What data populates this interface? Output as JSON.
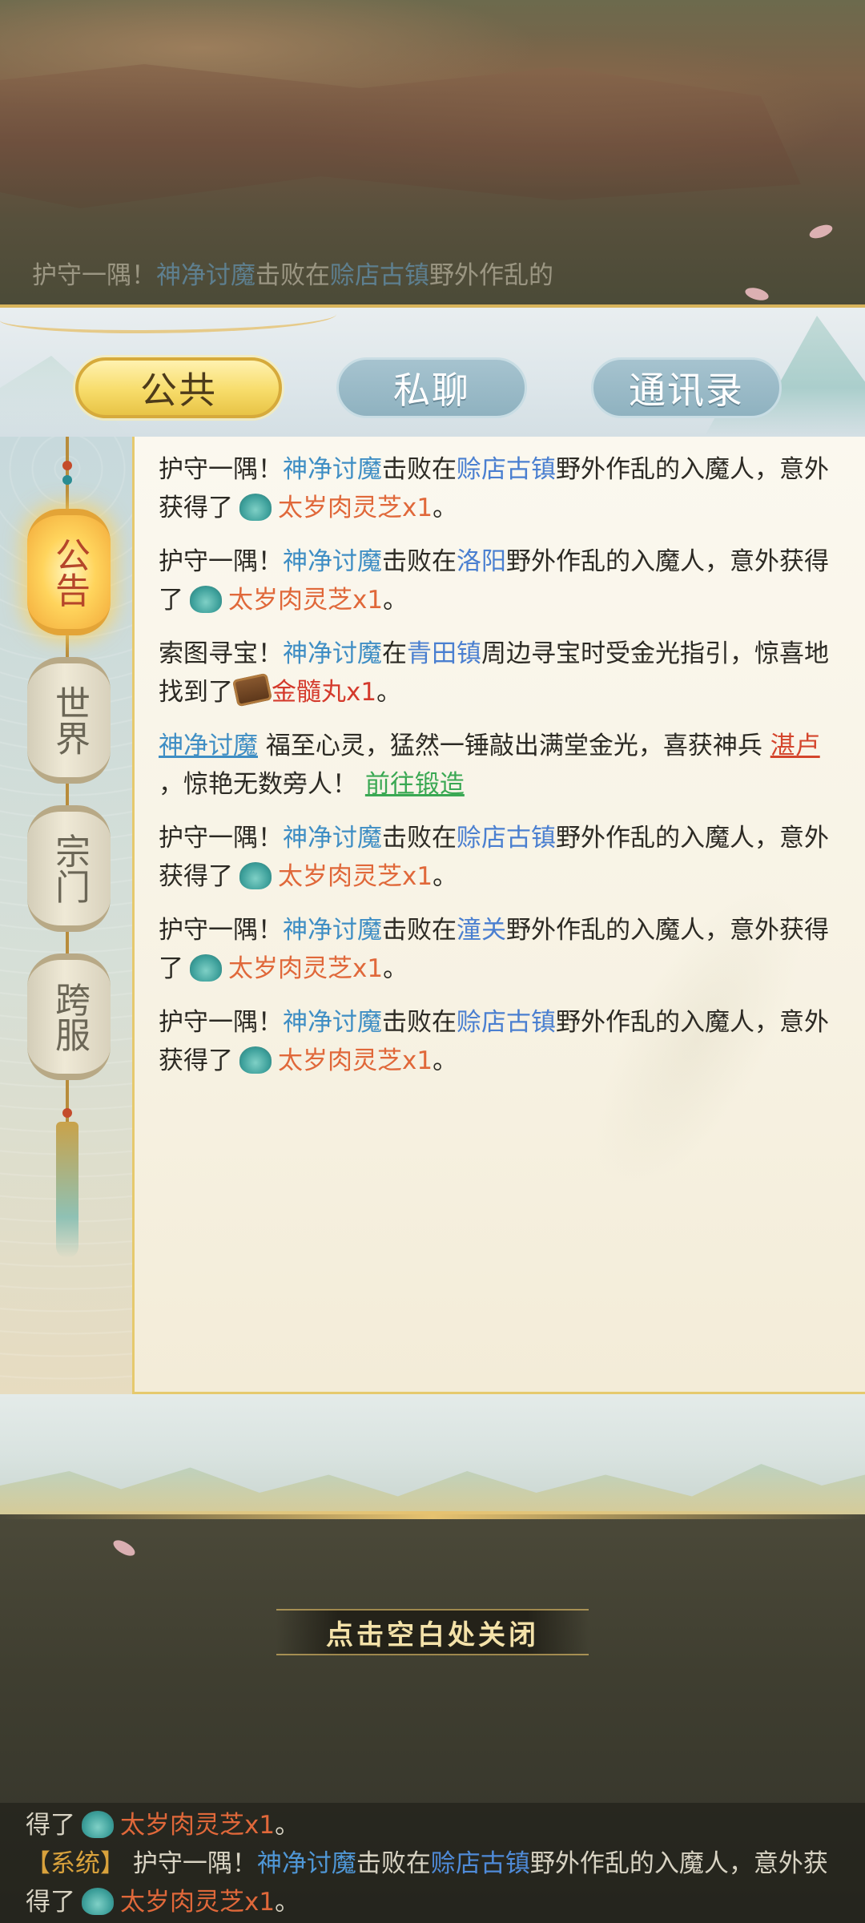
{
  "background_ticker": {
    "prefix": "护守一隅！",
    "player": "神净讨魔",
    "mid": "击败在",
    "location": "赊店古镇",
    "suffix": "野外作乱的"
  },
  "tabs": {
    "public": "公共",
    "private": "私聊",
    "contacts": "通讯录"
  },
  "channels": [
    "公告",
    "世界",
    "宗门",
    "跨服"
  ],
  "messages": [
    {
      "prefix": "护守一隅！",
      "player": "神净讨魔",
      "mid": "击败在",
      "location": "赊店古镇",
      "suffix": "野外作乱的入魔人，意外获得了",
      "item": "太岁肉灵芝x1",
      "end": "。"
    },
    {
      "prefix": "护守一隅！",
      "player": "神净讨魔",
      "mid": "击败在",
      "location": "洛阳",
      "suffix": "野外作乱的入魔人，意外获得了",
      "item": "太岁肉灵芝x1",
      "end": "。"
    },
    {
      "prefix": "索图寻宝！",
      "player": "神净讨魔",
      "mid": "在",
      "location": "青田镇",
      "suffix": "周边寻宝时受金光指引，惊喜地找到了",
      "item": "金髓丸x1",
      "end": "。"
    },
    {
      "player": "神净讨魔",
      "text1": " 福至心灵，猛然一锤敲出满堂金光，喜获神兵 ",
      "weapon": "湛卢",
      "text2": " ，惊艳无数旁人！ ",
      "link": "前往锻造"
    },
    {
      "prefix": "护守一隅！",
      "player": "神净讨魔",
      "mid": "击败在",
      "location": "赊店古镇",
      "suffix": "野外作乱的入魔人，意外获得了",
      "item": "太岁肉灵芝x1",
      "end": "。"
    },
    {
      "prefix": "护守一隅！",
      "player": "神净讨魔",
      "mid": "击败在",
      "location": "潼关",
      "suffix": "野外作乱的入魔人，意外获得了",
      "item": "太岁肉灵芝x1",
      "end": "。"
    },
    {
      "prefix": "护守一隅！",
      "player": "神净讨魔",
      "mid": "击败在",
      "location": "赊店古镇",
      "suffix": "野外作乱的入魔人，意外获得了",
      "item": "太岁肉灵芝x1",
      "end": "。"
    }
  ],
  "close_hint": "点击空白处关闭",
  "chat_bar": {
    "line1_text": "得了",
    "line1_item": "太岁肉灵芝x1",
    "line1_end": "。",
    "sys_tag": "【系统】",
    "prefix": " 护守一隅！",
    "player": "神净讨魔",
    "mid": "击败在",
    "location": "赊店古镇",
    "suffix": "野外作乱的入魔人，意外获得了",
    "item": "太岁肉灵芝x1",
    "end": "。"
  },
  "colors": {
    "player": "#3f8ec4",
    "location": "#4a7fd0",
    "item": "#e0683a",
    "item_rare": "#d43a2c",
    "link": "#3aa853",
    "tab_active": "#f7dc6a"
  }
}
